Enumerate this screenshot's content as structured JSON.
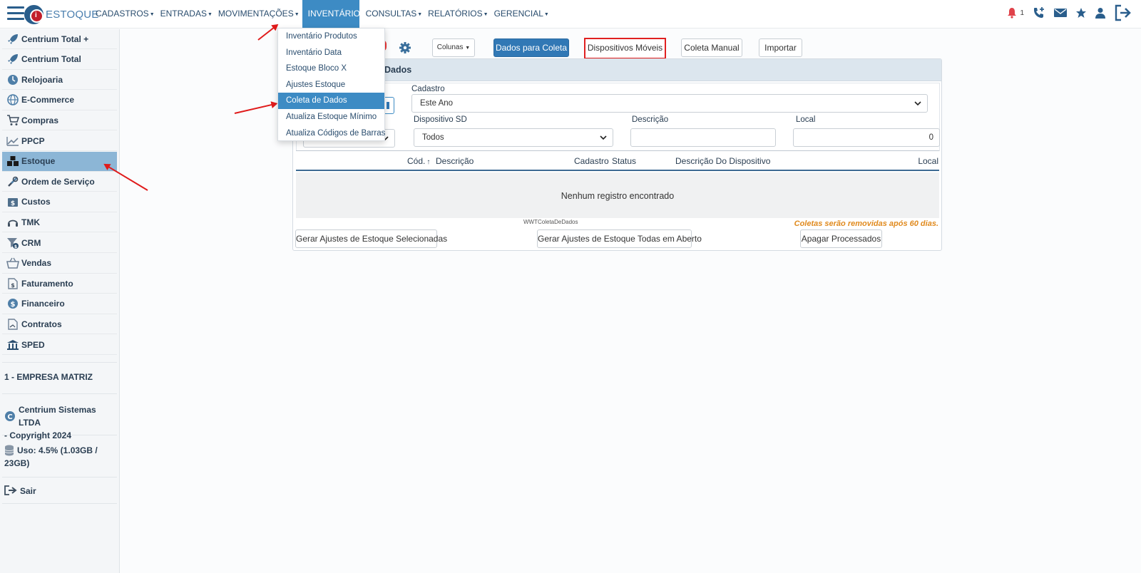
{
  "brand": "ESTOQUE",
  "menu": [
    {
      "label": "CADASTROS"
    },
    {
      "label": "ENTRADAS"
    },
    {
      "label": "MOVIMENTAÇÕES"
    },
    {
      "label": "INVENTÁRIO",
      "active": true
    },
    {
      "label": "CONSULTAS"
    },
    {
      "label": "RELATÓRIOS"
    },
    {
      "label": "GERENCIAL"
    }
  ],
  "top_icons": {
    "bell_count": "1",
    "icons": [
      "bell-icon",
      "phone-add-icon",
      "mail-icon",
      "star-icon",
      "user-icon",
      "logout-icon"
    ]
  },
  "dropdown": {
    "items": [
      {
        "label": "Inventário Produtos"
      },
      {
        "label": "Inventário Data"
      },
      {
        "label": "Estoque Bloco X"
      },
      {
        "label": "Ajustes Estoque"
      },
      {
        "label": "Coleta de Dados",
        "selected": true
      },
      {
        "label": "Atualiza Estoque Mínimo"
      },
      {
        "label": "Atualiza Códigos de Barras"
      }
    ]
  },
  "sidebar": {
    "items": [
      {
        "label": "Centrium Total +",
        "icon": "rocket-icon"
      },
      {
        "label": "Centrium Total",
        "icon": "rocket-icon"
      },
      {
        "label": "Relojoaria",
        "icon": "clock-icon"
      },
      {
        "label": "E-Commerce",
        "icon": "globe-icon"
      },
      {
        "label": "Compras",
        "icon": "cart-icon"
      },
      {
        "label": "PPCP",
        "icon": "chart-icon"
      },
      {
        "label": "Estoque",
        "icon": "boxes-icon",
        "active": true
      },
      {
        "label": "Ordem de Serviço",
        "icon": "tools-icon"
      },
      {
        "label": "Custos",
        "icon": "money-icon"
      },
      {
        "label": "TMK",
        "icon": "headset-icon"
      },
      {
        "label": "CRM",
        "icon": "funnel-icon"
      },
      {
        "label": "Vendas",
        "icon": "basket-icon"
      },
      {
        "label": "Faturamento",
        "icon": "invoice-icon"
      },
      {
        "label": "Financeiro",
        "icon": "dollar-icon"
      },
      {
        "label": "Contratos",
        "icon": "contract-icon"
      },
      {
        "label": "SPED",
        "icon": "bank-icon"
      }
    ],
    "company": "1 - EMPRESA MATRIZ",
    "copyright_line1": "Centrium Sistemas LTDA",
    "copyright_line2": "- Copyright 2024",
    "usage_line1": "Uso: 4.5% (1.03GB /",
    "usage_line2": "23GB)",
    "logout": "Sair"
  },
  "toolbar": {
    "columns": "Colunas",
    "data_collection": "Dados para Coleta",
    "mobile_devices": "Dispositivos Móveis",
    "manual_collection": "Coleta Manual",
    "import": "Importar"
  },
  "panel": {
    "title": "Dados",
    "cadastro_label": "Cadastro",
    "cadastro_value": "Este Ano",
    "dispositivo_label": "Dispositivo SD",
    "dispositivo_value": "Todos",
    "descricao_label": "Descrição",
    "descricao_value": "",
    "local_label": "Local",
    "local_value": "0"
  },
  "table": {
    "columns": [
      "Cód.",
      "Descrição",
      "Cadastro",
      "Status",
      "Descrição Do Dispositivo",
      "Local"
    ],
    "empty": "Nenhum registro encontrado",
    "footer_id": "WWTColetaDeDados",
    "warning": "Coletas serão removidas após 60 dias."
  },
  "actions": {
    "generate_selected": "Gerar Ajustes de Estoque Selecionadas",
    "generate_all": "Gerar Ajustes de Estoque Todas em Aberto",
    "delete_processed": "Apagar Processados"
  }
}
